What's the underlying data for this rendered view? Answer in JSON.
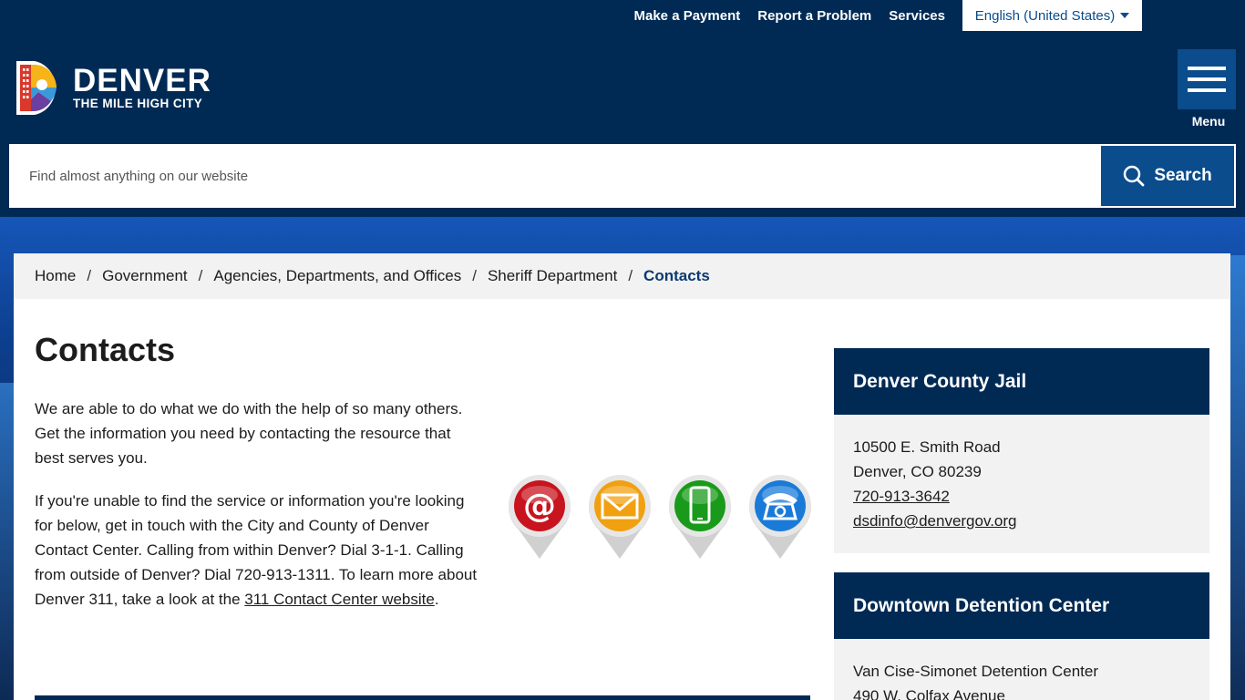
{
  "utility_nav": {
    "make_payment": "Make a Payment",
    "report_problem": "Report a Problem",
    "services": "Services",
    "language": "English (United States)"
  },
  "logo": {
    "name": "DENVER",
    "tagline": "THE MILE HIGH CITY"
  },
  "menu": {
    "label": "Menu"
  },
  "search": {
    "placeholder": "Find almost anything on our website",
    "button_label": "Search"
  },
  "breadcrumb": {
    "items": [
      "Home",
      "Government",
      "Agencies, Departments, and Offices",
      "Sheriff Department"
    ],
    "current": "Contacts",
    "separator": "/"
  },
  "main": {
    "title": "Contacts",
    "para1": "We are able to do what we do with the help of so many others. Get the information you need by contacting the resource that best serves you.",
    "para2_text": "If you're unable to find the service or information you're looking for below, get in touch with the City and County of Denver Contact Center. Calling from within Denver? Dial 3-1-1. Calling from outside of Denver? Dial 720-913-1311. To learn more about Denver 311, take a look at the ",
    "para2_link": "311 Contact Center website",
    "para2_end": "."
  },
  "icons": [
    "email-at-icon",
    "envelope-icon",
    "mobile-phone-icon",
    "telephone-icon"
  ],
  "colors": {
    "navy": "#002a54",
    "accent_blue": "#0a4c8c",
    "icon_red": "#c8141e",
    "icon_orange": "#f0a010",
    "icon_green": "#1a9a1a",
    "icon_blue": "#1a7ad8"
  },
  "sidebar": {
    "jail": {
      "title": "Denver County Jail",
      "address1": "10500 E. Smith Road",
      "address2": "Denver, CO 80239",
      "phone": "720-913-3642",
      "email": "dsdinfo@denvergov.org"
    },
    "downtown": {
      "title": "Downtown Detention Center",
      "line1": "Van Cise-Simonet Detention Center",
      "line2": "490 W. Colfax Avenue"
    }
  }
}
